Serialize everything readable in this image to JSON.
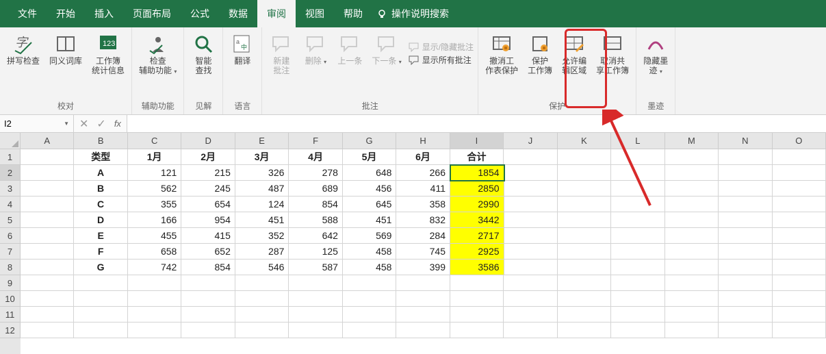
{
  "tabs": [
    "文件",
    "开始",
    "插入",
    "页面布局",
    "公式",
    "数据",
    "审阅",
    "视图",
    "帮助"
  ],
  "tell_me": "操作说明搜索",
  "active_tab_index": 6,
  "ribbon": {
    "groups": [
      {
        "label": "校对",
        "buttons": [
          {
            "name": "spellcheck-button",
            "label": "拼写检查",
            "icon": "spell"
          },
          {
            "name": "thesaurus-button",
            "label": "同义词库",
            "icon": "book"
          },
          {
            "name": "workbook-stats-button",
            "label": "工作簿\n统计信息",
            "icon": "stats"
          }
        ]
      },
      {
        "label": "辅助功能",
        "buttons": [
          {
            "name": "accessibility-check-button",
            "label": "检查\n辅助功能",
            "icon": "access",
            "dropdown": true
          }
        ]
      },
      {
        "label": "见解",
        "buttons": [
          {
            "name": "smart-lookup-button",
            "label": "智能\n查找",
            "icon": "search"
          }
        ]
      },
      {
        "label": "语言",
        "buttons": [
          {
            "name": "translate-button",
            "label": "翻译",
            "icon": "translate"
          }
        ]
      },
      {
        "label": "批注",
        "buttons": [
          {
            "name": "new-comment-button",
            "label": "新建\n批注",
            "icon": "comment",
            "disabled": true
          },
          {
            "name": "delete-comment-button",
            "label": "删除",
            "icon": "comment-del",
            "disabled": true,
            "dropdown": true
          },
          {
            "name": "prev-comment-button",
            "label": "上一条",
            "icon": "comment-prev",
            "disabled": true
          },
          {
            "name": "next-comment-button",
            "label": "下一条",
            "icon": "comment-next",
            "disabled": true,
            "dropdown": true
          }
        ],
        "options": [
          {
            "name": "toggle-comments-button",
            "label": "显示/隐藏批注",
            "disabled": true
          },
          {
            "name": "show-all-comments-button",
            "label": "显示所有批注",
            "disabled": false
          }
        ]
      },
      {
        "label": "保护",
        "buttons": [
          {
            "name": "unprotect-sheet-button",
            "label": "撤消工\n作表保护",
            "icon": "unprotect",
            "highlighted": true
          },
          {
            "name": "protect-workbook-button",
            "label": "保护\n工作簿",
            "icon": "protect-wb"
          },
          {
            "name": "allow-edit-ranges-button",
            "label": "允许编\n辑区域",
            "icon": "allow-edit"
          },
          {
            "name": "unshare-workbook-button",
            "label": "取消共\n享工作簿",
            "icon": "unshare"
          }
        ]
      },
      {
        "label": "墨迹",
        "buttons": [
          {
            "name": "hide-ink-button",
            "label": "隐藏墨\n迹",
            "icon": "ink",
            "dropdown": true
          }
        ]
      }
    ]
  },
  "namebox": "I2",
  "formula": "",
  "columns": [
    "A",
    "B",
    "C",
    "D",
    "E",
    "F",
    "G",
    "H",
    "I",
    "J",
    "K",
    "L",
    "M",
    "N",
    "O"
  ],
  "row_count": 12,
  "selected": {
    "row": 2,
    "col": "I"
  },
  "table": {
    "header_row": 1,
    "start_col": "B",
    "headers": [
      "类型",
      "1月",
      "2月",
      "3月",
      "4月",
      "5月",
      "6月",
      "合计"
    ],
    "rows": [
      [
        "A",
        121,
        215,
        326,
        278,
        648,
        266,
        1854
      ],
      [
        "B",
        562,
        245,
        487,
        689,
        456,
        411,
        2850
      ],
      [
        "C",
        355,
        654,
        124,
        854,
        645,
        358,
        2990
      ],
      [
        "D",
        166,
        954,
        451,
        588,
        451,
        832,
        3442
      ],
      [
        "E",
        455,
        415,
        352,
        642,
        569,
        284,
        2717
      ],
      [
        "F",
        658,
        652,
        287,
        125,
        458,
        745,
        2925
      ],
      [
        "G",
        742,
        854,
        546,
        587,
        458,
        399,
        3586
      ]
    ],
    "highlight_col": "I"
  }
}
